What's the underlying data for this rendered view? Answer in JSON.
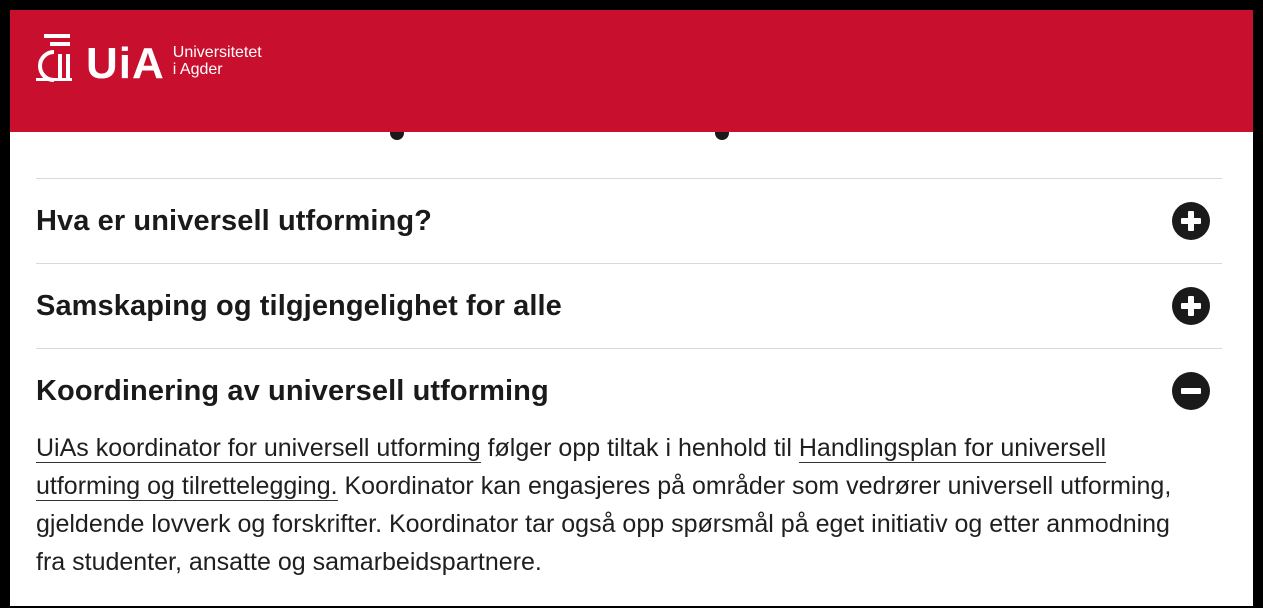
{
  "header": {
    "logo_short": "UiA",
    "logo_line1": "Universitetet",
    "logo_line2": "i Agder",
    "background": "#c8102e"
  },
  "accordion": [
    {
      "title": "Hva er universell utforming?",
      "state": "collapsed",
      "icon": "plus-circle-icon"
    },
    {
      "title": "Samskaping og tilgjengelighet for alle",
      "state": "collapsed",
      "icon": "plus-circle-icon"
    },
    {
      "title": "Koordinering av universell utforming",
      "state": "expanded",
      "icon": "minus-circle-icon"
    }
  ],
  "expanded_body": {
    "link1": "UiAs koordinator for universell utforming",
    "text1": " følger opp tiltak i henhold til ",
    "link2": "Handlingsplan for universell utforming og tilrettelegging.",
    "text2": " Koordinator kan engasjeres på områder som vedrører universell utforming, gjeldende lovverk og forskrifter. Koordinator tar også opp spørsmål på eget initiativ og etter anmodning fra studenter, ansatte og samarbeidspartnere."
  }
}
